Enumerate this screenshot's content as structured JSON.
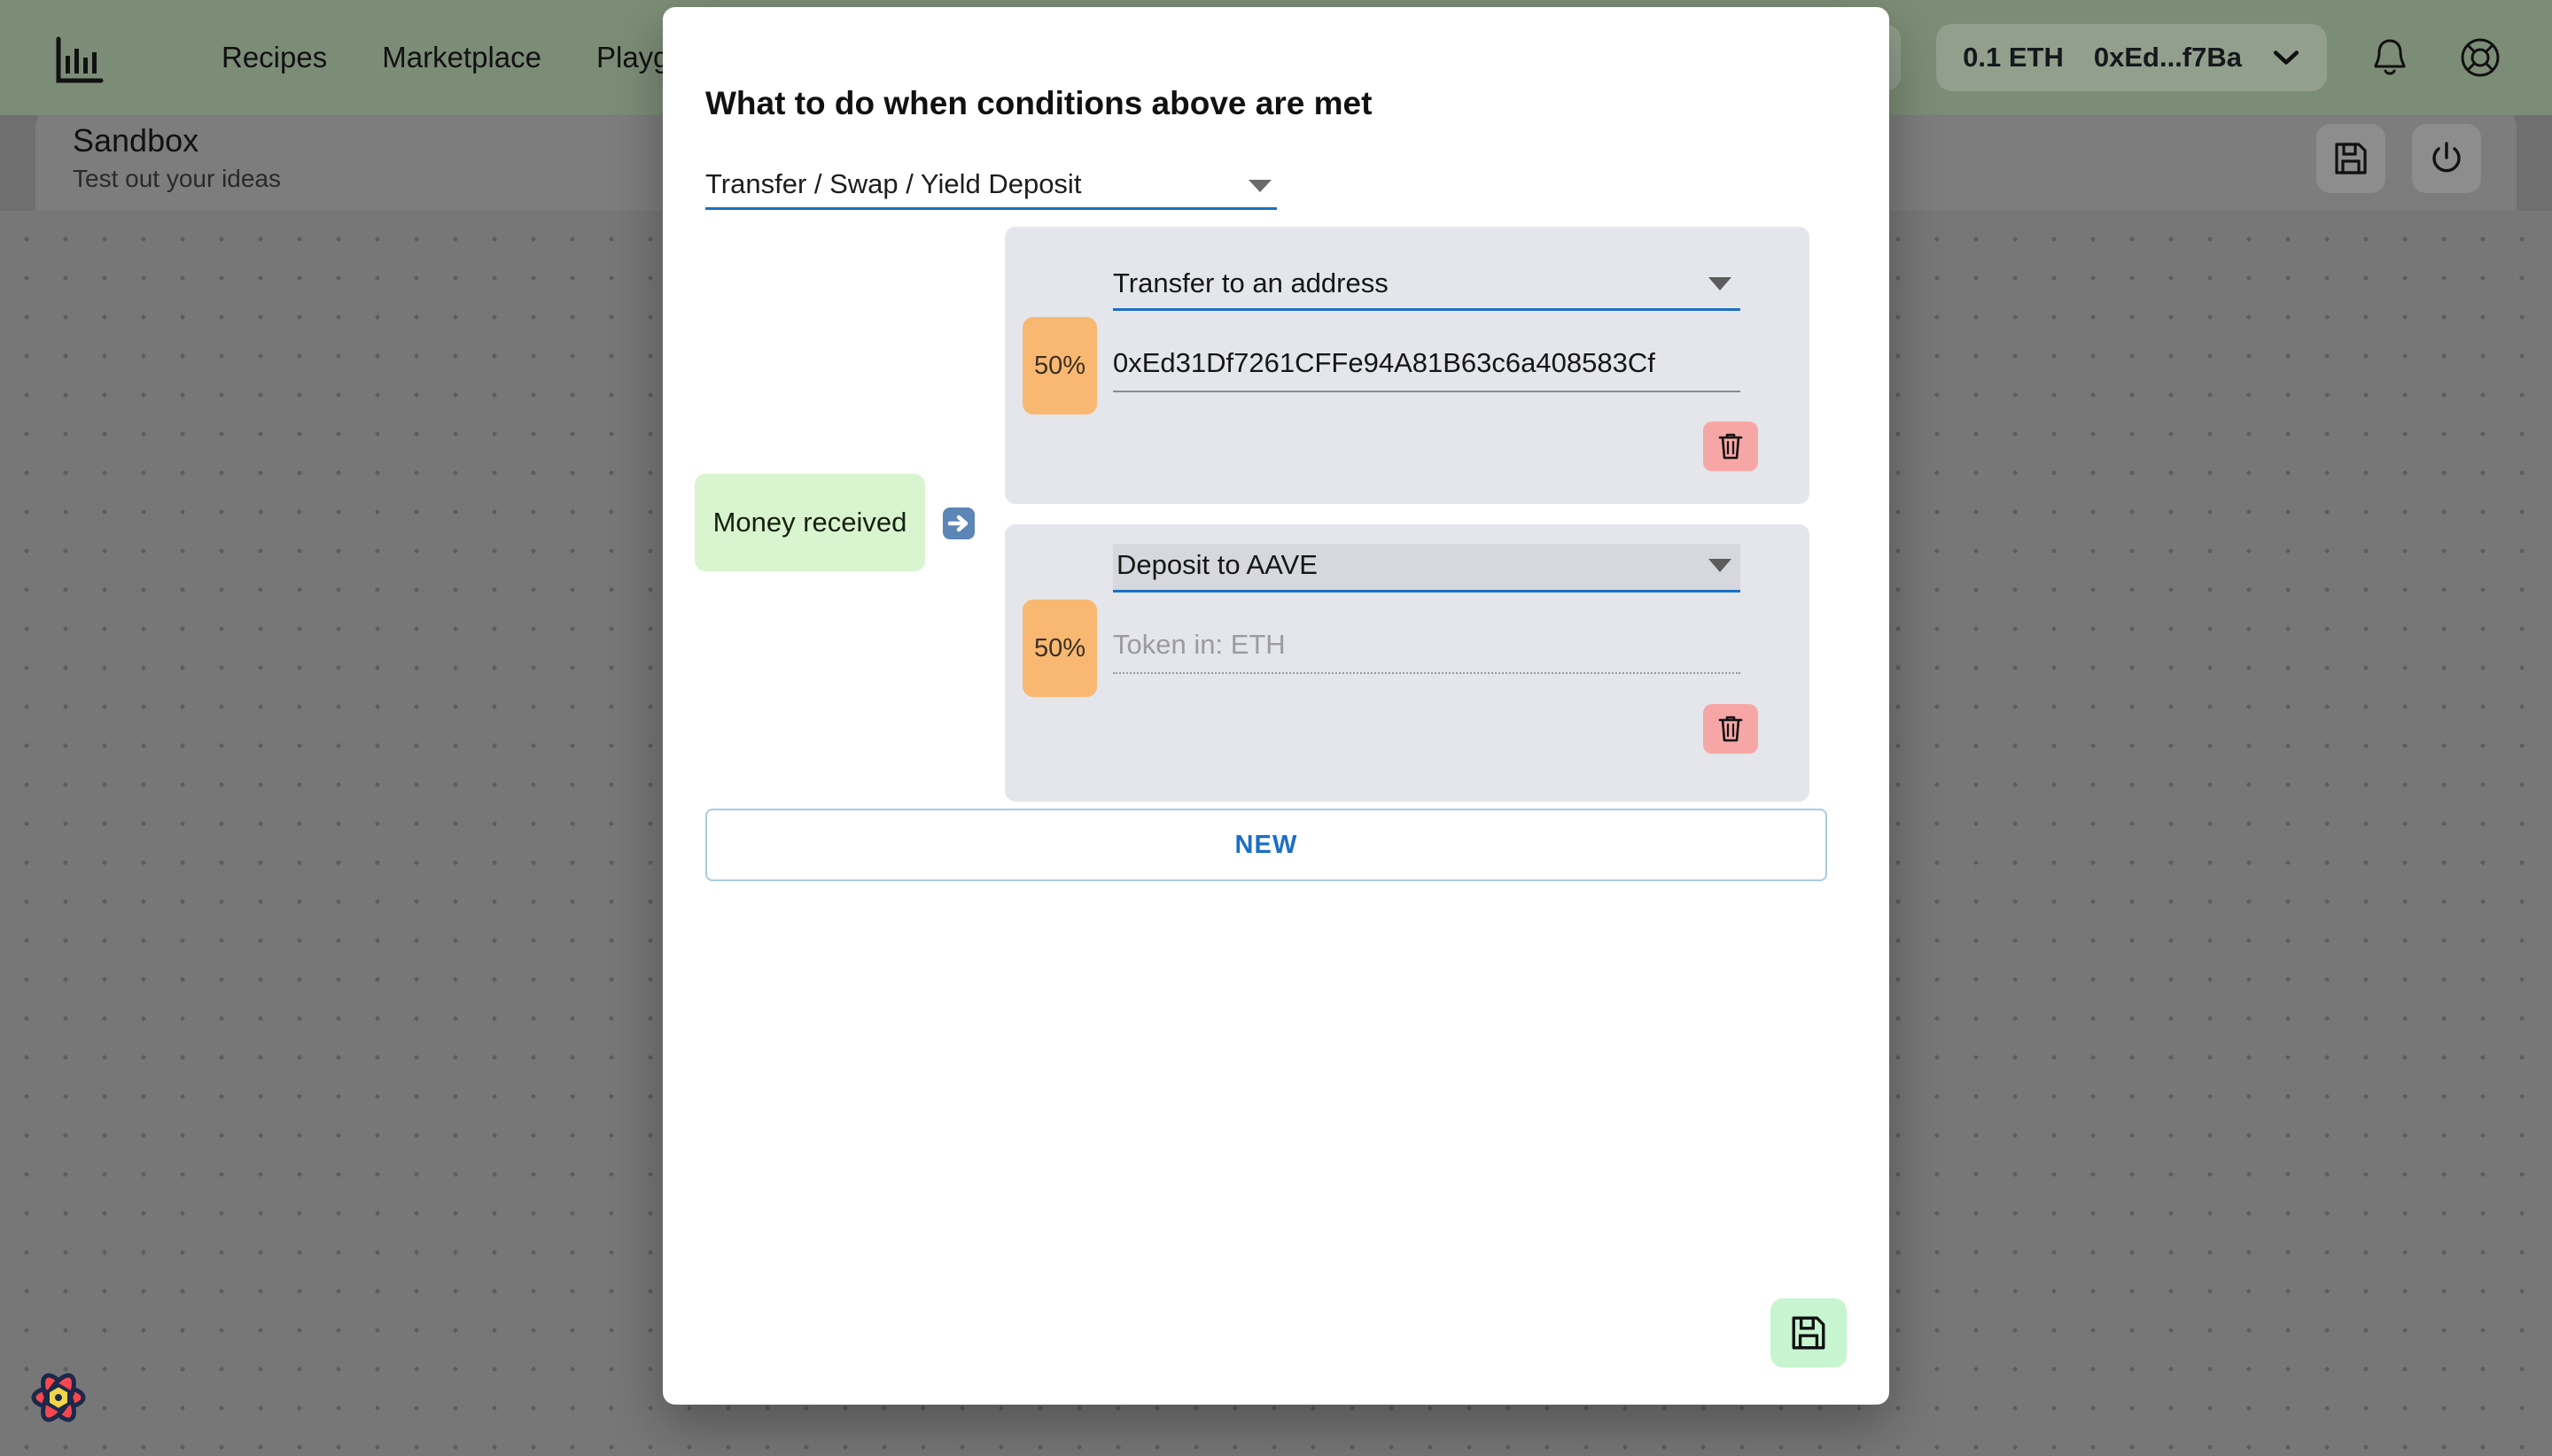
{
  "navbar": {
    "logo_icon": "bar-chart-logo-icon",
    "links": [
      {
        "label": "Recipes"
      },
      {
        "label": "Marketplace"
      },
      {
        "label": "Playground"
      }
    ],
    "network": {
      "icon": "ethereum-logo-icon",
      "chevron_icon": "chevron-down-icon"
    },
    "wallet": {
      "balance": "0.1 ETH",
      "address": "0xEd...f7Ba",
      "chevron_icon": "chevron-down-icon"
    },
    "notifications_icon": "bell-icon",
    "help_icon": "lifebuoy-icon"
  },
  "page_header": {
    "title": "Sandbox",
    "subtitle": "Test out your ideas",
    "save_icon": "floppy-disk-icon",
    "power_icon": "power-icon"
  },
  "canvas": {
    "react_icon": "atom-icon"
  },
  "modal": {
    "title": "What to do when conditions above are met",
    "action_type_select": {
      "value": "Transfer / Swap / Yield Deposit",
      "caret_icon": "caret-down-icon"
    },
    "trigger_node": {
      "label": "Money received",
      "arrow_icon": "arrow-right-icon"
    },
    "actions": [
      {
        "percent": "50%",
        "action_select": {
          "value": "Transfer to an address",
          "caret_icon": "caret-down-icon"
        },
        "input": {
          "value": "0xEd31Df7261CFFe94A81B63c6a408583Cf",
          "placeholder": "",
          "is_placeholder": false
        },
        "delete_icon": "trash-icon"
      },
      {
        "percent": "50%",
        "action_select": {
          "value": "Deposit to AAVE",
          "caret_icon": "caret-down-icon"
        },
        "input": {
          "value": "",
          "placeholder": "Token in: ETH",
          "is_placeholder": true
        },
        "delete_icon": "trash-icon"
      }
    ],
    "new_button_label": "NEW",
    "save_icon": "floppy-disk-icon"
  },
  "colors": {
    "navbar_bg": "#7c8d77",
    "canvas_bg": "#777777",
    "accent_blue": "#1b6fc4",
    "trigger_green": "#d8f5cf",
    "percent_orange": "#f9b872",
    "card_gray": "#e4e6eb",
    "delete_red": "#f7a6a6",
    "save_green": "#c6f5cf"
  }
}
